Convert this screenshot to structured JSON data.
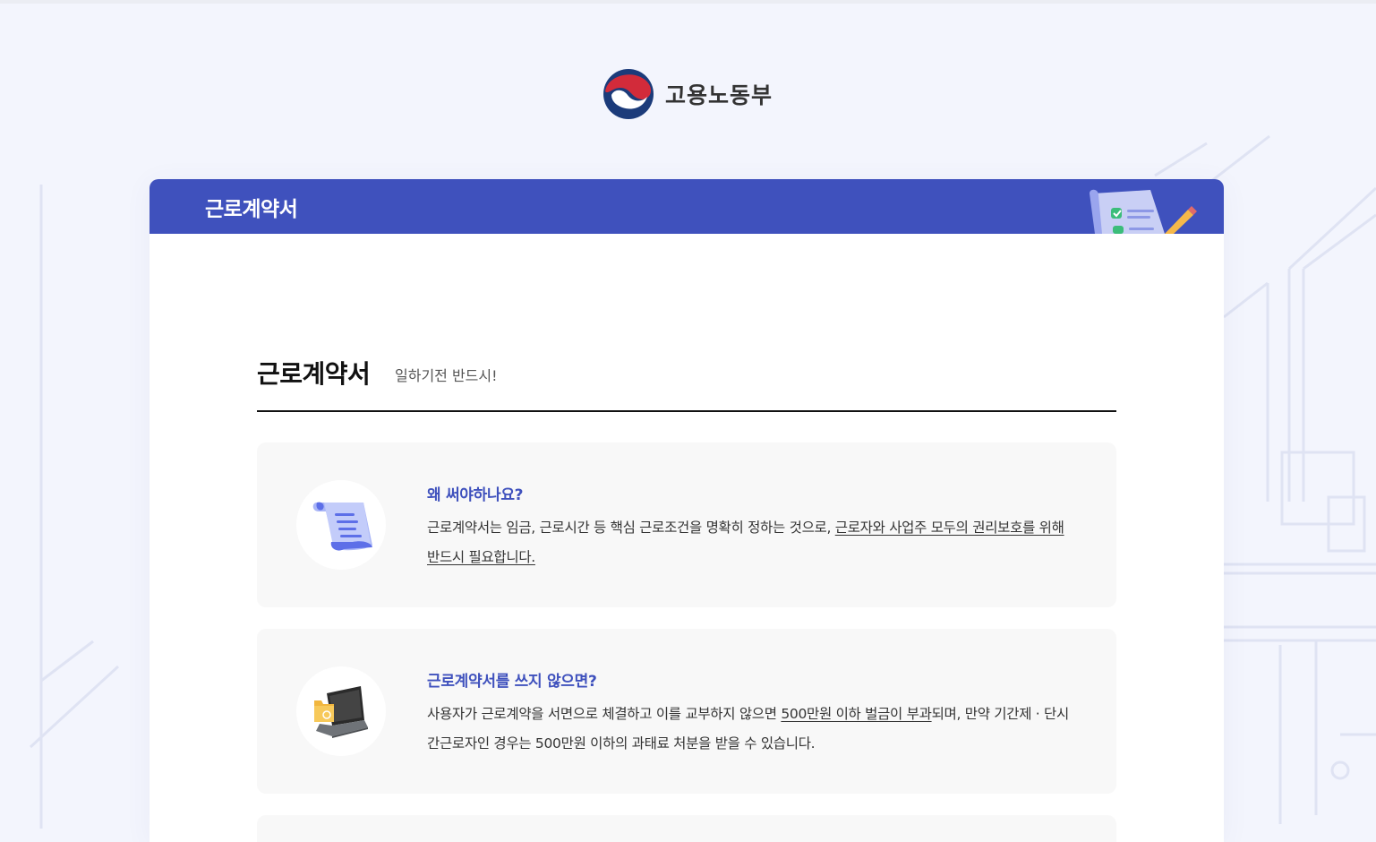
{
  "ministry": {
    "name": "고용노동부",
    "logo_icon": "taegeuk-emblem-icon"
  },
  "header": {
    "title": "근로계약서",
    "illustration": "checklist-pencil-icon"
  },
  "section": {
    "title": "근로계약서",
    "subtitle": "일하기전 반드시!"
  },
  "items": [
    {
      "title": "왜 써야하나요?",
      "icon": "scroll-document-icon",
      "body_plain": "근로계약서는 임금, 근로시간 등 핵심 근로조건을 명확히 정하는 것으로, ",
      "body_underline": "근로자와 사업주 모두의 권리보호를 위해 반드시 필요합니다.",
      "body_after": ""
    },
    {
      "title": "근로계약서를 쓰지 않으면?",
      "icon": "laptop-folder-icon",
      "body_plain": "사용자가 근로계약을 서면으로 체결하고 이를 교부하지 않으면 ",
      "body_underline": "500만원 이하 벌금이 부과",
      "body_after": "되며, 만약 기간제 · 단시간근로자인 경우는 500만원 이하의 과태료 처분을 받을 수 있습니다."
    }
  ],
  "colors": {
    "accent": "#3f51bd",
    "page_bg": "#f3f5fd",
    "box_bg": "#f8f8f8"
  }
}
